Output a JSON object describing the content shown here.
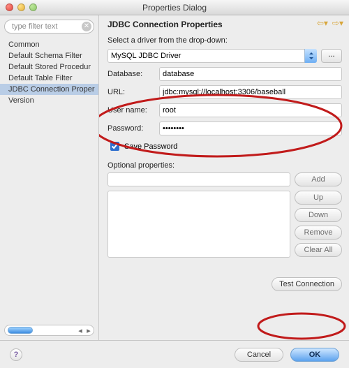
{
  "window": {
    "title": "Properties Dialog"
  },
  "sidebar": {
    "filter_placeholder": "type filter text",
    "items": [
      {
        "label": "Common"
      },
      {
        "label": "Default Schema Filter"
      },
      {
        "label": "Default Stored Procedur"
      },
      {
        "label": "Default Table Filter"
      },
      {
        "label": "JDBC Connection Proper"
      },
      {
        "label": "Version"
      }
    ],
    "selected_index": 4
  },
  "main": {
    "heading": "JDBC Connection Properties",
    "driver_prompt": "Select a driver from the drop-down:",
    "driver_selected": "MySQL JDBC Driver",
    "more_button": "...",
    "database_label": "Database:",
    "database_value": "database",
    "url_label": "URL:",
    "url_value": "jdbc:mysql://localhost:3306/baseball",
    "user_label": "User name:",
    "user_value": "root",
    "password_label": "Password:",
    "password_value": "••••••••",
    "save_pw_label": "Save Password",
    "save_pw_checked": true,
    "optional_label": "Optional properties:",
    "optional_value": "",
    "buttons": {
      "add": "Add",
      "up": "Up",
      "down": "Down",
      "remove": "Remove",
      "clear_all": "Clear All",
      "test": "Test Connection"
    }
  },
  "footer": {
    "help": "?",
    "cancel": "Cancel",
    "ok": "OK"
  }
}
